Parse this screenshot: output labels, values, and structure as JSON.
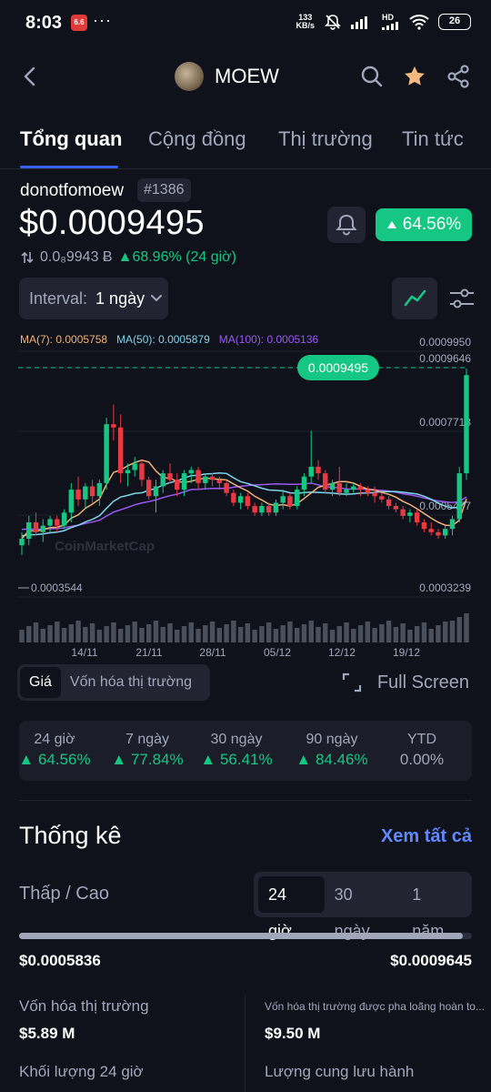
{
  "status_bar": {
    "time": "8:03",
    "app_badge": "6.6",
    "net_speed_value": "133",
    "net_speed_unit": "KB/s",
    "battery": "26",
    "signal_tag": "HD"
  },
  "header": {
    "coin_name": "MOEW"
  },
  "tabs": [
    {
      "label": "Tổng quan"
    },
    {
      "label": "Cộng đồng"
    },
    {
      "label": "Thị trường"
    },
    {
      "label": "Tin tức"
    }
  ],
  "coin": {
    "symbol": "donotfomoew",
    "rank": "#1386",
    "price": "$0.0009495",
    "change_badge": "64.56%",
    "btc_price": "0.0₈9943 Ƀ",
    "btc_change": "68.96% (24 giờ)"
  },
  "interval": {
    "label": "Interval:",
    "value": "1 ngày"
  },
  "chart_data": {
    "type": "candlestick",
    "ma": [
      {
        "label": "MA(7): 0.0005758",
        "color": "#f0b27a"
      },
      {
        "label": "MA(50): 0.0005879",
        "color": "#7fd6ec"
      },
      {
        "label": "MA(100): 0.0005136",
        "color": "#9b59f5"
      }
    ],
    "y_labels": [
      "0.0009950",
      "0.0009646",
      "0.0007713",
      "0.0005477",
      "0.0003239"
    ],
    "low_marker": "0.0003544",
    "current_price_label": "0.0009495",
    "x_labels": [
      "14/11",
      "21/11",
      "28/11",
      "05/12",
      "12/12",
      "19/12"
    ],
    "watermark": "CoinMarketCap",
    "candles": [
      {
        "o": 0.00043,
        "h": 0.00047,
        "l": 0.0004,
        "c": 0.00045
      },
      {
        "o": 0.00045,
        "h": 0.00052,
        "l": 0.00043,
        "c": 0.0005
      },
      {
        "o": 0.0005,
        "h": 0.00053,
        "l": 0.00046,
        "c": 0.00047
      },
      {
        "o": 0.00047,
        "h": 0.00051,
        "l": 0.00044,
        "c": 0.00049
      },
      {
        "o": 0.00049,
        "h": 0.00052,
        "l": 0.00047,
        "c": 0.00051
      },
      {
        "o": 0.00051,
        "h": 0.00052,
        "l": 0.00047,
        "c": 0.00049
      },
      {
        "o": 0.00049,
        "h": 0.00054,
        "l": 0.00048,
        "c": 0.00053
      },
      {
        "o": 0.00053,
        "h": 0.00062,
        "l": 0.0005,
        "c": 0.0006
      },
      {
        "o": 0.0006,
        "h": 0.00064,
        "l": 0.00055,
        "c": 0.00057
      },
      {
        "o": 0.00057,
        "h": 0.00062,
        "l": 0.00054,
        "c": 0.00061
      },
      {
        "o": 0.00061,
        "h": 0.00063,
        "l": 0.00056,
        "c": 0.00058
      },
      {
        "o": 0.00058,
        "h": 0.00063,
        "l": 0.00055,
        "c": 0.00062
      },
      {
        "o": 0.00062,
        "h": 0.00082,
        "l": 0.0006,
        "c": 0.0008
      },
      {
        "o": 0.0008,
        "h": 0.00086,
        "l": 0.00075,
        "c": 0.00079
      },
      {
        "o": 0.00079,
        "h": 0.00083,
        "l": 0.00062,
        "c": 0.00065
      },
      {
        "o": 0.00065,
        "h": 0.00068,
        "l": 0.00061,
        "c": 0.00066
      },
      {
        "o": 0.00066,
        "h": 0.0007,
        "l": 0.00064,
        "c": 0.00068
      },
      {
        "o": 0.00068,
        "h": 0.00069,
        "l": 0.00061,
        "c": 0.00063
      },
      {
        "o": 0.00063,
        "h": 0.00064,
        "l": 0.00057,
        "c": 0.00058
      },
      {
        "o": 0.00058,
        "h": 0.00063,
        "l": 0.00053,
        "c": 0.00061
      },
      {
        "o": 0.00061,
        "h": 0.00066,
        "l": 0.00059,
        "c": 0.00065
      },
      {
        "o": 0.00065,
        "h": 0.00068,
        "l": 0.00062,
        "c": 0.00063
      },
      {
        "o": 0.00063,
        "h": 0.00065,
        "l": 0.00058,
        "c": 0.0006
      },
      {
        "o": 0.0006,
        "h": 0.00066,
        "l": 0.00058,
        "c": 0.00065
      },
      {
        "o": 0.00065,
        "h": 0.00067,
        "l": 0.00062,
        "c": 0.00066
      },
      {
        "o": 0.00066,
        "h": 0.00067,
        "l": 0.0006,
        "c": 0.00062
      },
      {
        "o": 0.00062,
        "h": 0.00065,
        "l": 0.0006,
        "c": 0.00064
      },
      {
        "o": 0.00064,
        "h": 0.00065,
        "l": 0.00061,
        "c": 0.00063
      },
      {
        "o": 0.00063,
        "h": 0.00064,
        "l": 0.0006,
        "c": 0.00062
      },
      {
        "o": 0.00062,
        "h": 0.00063,
        "l": 0.00058,
        "c": 0.00059
      },
      {
        "o": 0.00059,
        "h": 0.0006,
        "l": 0.00055,
        "c": 0.00056
      },
      {
        "o": 0.00056,
        "h": 0.00059,
        "l": 0.00054,
        "c": 0.00058
      },
      {
        "o": 0.00058,
        "h": 0.00059,
        "l": 0.00054,
        "c": 0.00055
      },
      {
        "o": 0.00055,
        "h": 0.00056,
        "l": 0.00052,
        "c": 0.00053
      },
      {
        "o": 0.00053,
        "h": 0.00056,
        "l": 0.00052,
        "c": 0.00055
      },
      {
        "o": 0.00055,
        "h": 0.00056,
        "l": 0.00052,
        "c": 0.00053
      },
      {
        "o": 0.00053,
        "h": 0.00057,
        "l": 0.00052,
        "c": 0.00056
      },
      {
        "o": 0.00056,
        "h": 0.0006,
        "l": 0.00054,
        "c": 0.00058
      },
      {
        "o": 0.00058,
        "h": 0.00059,
        "l": 0.00054,
        "c": 0.00055
      },
      {
        "o": 0.00055,
        "h": 0.00061,
        "l": 0.00054,
        "c": 0.0006
      },
      {
        "o": 0.0006,
        "h": 0.00065,
        "l": 0.00058,
        "c": 0.00064
      },
      {
        "o": 0.00064,
        "h": 0.00078,
        "l": 0.00062,
        "c": 0.00067
      },
      {
        "o": 0.00067,
        "h": 0.00069,
        "l": 0.00063,
        "c": 0.00065
      },
      {
        "o": 0.00065,
        "h": 0.00066,
        "l": 0.00059,
        "c": 0.0006
      },
      {
        "o": 0.0006,
        "h": 0.00063,
        "l": 0.00058,
        "c": 0.00062
      },
      {
        "o": 0.00062,
        "h": 0.00067,
        "l": 0.00058,
        "c": 0.00059
      },
      {
        "o": 0.00059,
        "h": 0.00062,
        "l": 0.00058,
        "c": 0.0006
      },
      {
        "o": 0.0006,
        "h": 0.00062,
        "l": 0.00059,
        "c": 0.00061
      },
      {
        "o": 0.00061,
        "h": 0.00062,
        "l": 0.00058,
        "c": 0.0006
      },
      {
        "o": 0.0006,
        "h": 0.00061,
        "l": 0.00058,
        "c": 0.00059
      },
      {
        "o": 0.00059,
        "h": 0.00061,
        "l": 0.00056,
        "c": 0.00058
      },
      {
        "o": 0.00058,
        "h": 0.00059,
        "l": 0.00056,
        "c": 0.00057
      },
      {
        "o": 0.00057,
        "h": 0.00058,
        "l": 0.00054,
        "c": 0.00055
      },
      {
        "o": 0.00055,
        "h": 0.00056,
        "l": 0.00053,
        "c": 0.00054
      },
      {
        "o": 0.00054,
        "h": 0.00055,
        "l": 0.00051,
        "c": 0.00052
      },
      {
        "o": 0.00052,
        "h": 0.00054,
        "l": 0.0005,
        "c": 0.00053
      },
      {
        "o": 0.00053,
        "h": 0.00054,
        "l": 0.00049,
        "c": 0.0005
      },
      {
        "o": 0.0005,
        "h": 0.00051,
        "l": 0.00047,
        "c": 0.00048
      },
      {
        "o": 0.00048,
        "h": 0.0005,
        "l": 0.00046,
        "c": 0.00047
      },
      {
        "o": 0.00047,
        "h": 0.00048,
        "l": 0.00045,
        "c": 0.00046
      },
      {
        "o": 0.00046,
        "h": 0.00049,
        "l": 0.00045,
        "c": 0.00048
      },
      {
        "o": 0.00048,
        "h": 0.00052,
        "l": 0.00046,
        "c": 0.00051
      },
      {
        "o": 0.00051,
        "h": 0.00067,
        "l": 0.0005,
        "c": 0.00065
      },
      {
        "o": 0.00065,
        "h": 0.00097,
        "l": 0.00063,
        "c": 0.00095
      }
    ]
  },
  "view_toggle": {
    "price": "Giá",
    "market_cap": "Vốn hóa thị trường"
  },
  "fullscreen_label": "Full Screen",
  "performance": [
    {
      "period": "24 giờ",
      "value": "64.56%"
    },
    {
      "period": "7 ngày",
      "value": "77.84%"
    },
    {
      "period": "30 ngày",
      "value": "56.41%"
    },
    {
      "period": "90 ngày",
      "value": "84.46%"
    },
    {
      "period": "YTD",
      "value": "0.00%"
    }
  ],
  "stats": {
    "title": "Thống kê",
    "see_all": "Xem tất cả",
    "low_high_label": "Thấp / Cao",
    "range_options": [
      "24 giờ",
      "30 ngày",
      "1 năm"
    ],
    "low": "$0.0005836",
    "high": "$0.0009645",
    "range_position": 0.98,
    "market_cap_label": "Vốn hóa thị trường",
    "market_cap": "$5.89 M",
    "fdv_label": "Vốn hóa thị trường được pha loãng hoàn to...",
    "fdv": "$9.50 M",
    "volume_label": "Khối lượng 24 giờ",
    "supply_label": "Lượng cung lưu hành"
  },
  "colors": {
    "background": "#0f121a",
    "up": "#16c784",
    "down": "#ea3943",
    "accent": "#3861fb",
    "link": "#6188ff"
  }
}
